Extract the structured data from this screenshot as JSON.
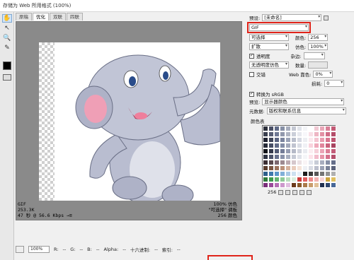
{
  "window": {
    "title": "存储为 Web 所用格式 (100%)"
  },
  "tabs": [
    {
      "label": "原稿"
    },
    {
      "label": "优化"
    },
    {
      "label": "双联"
    },
    {
      "label": "四联"
    }
  ],
  "image_info": {
    "format": "GIF",
    "size": "253.3K",
    "time": "47 秒 @ 56.6 Kbps",
    "time_arrow": "→≡",
    "dither": "100% 仿色",
    "palette": "\"可选择\" 调板",
    "colors": "256 颜色"
  },
  "statusbar": {
    "zoom": "100%",
    "r_label": "R:",
    "r_value": "--",
    "g_label": "G:",
    "g_value": "--",
    "b_label": "B:",
    "b_value": "--",
    "alpha_label": "Alpha:",
    "alpha_value": "--",
    "hex_label": "十六进制:",
    "hex_value": "--",
    "index_label": "索引:",
    "index_value": "--"
  },
  "settings": {
    "preset_label": "预设:",
    "preset_value": "[未命名]",
    "format_value": "GIF",
    "reduction_value": "可选择",
    "colors_label": "颜色:",
    "colors_value": "256",
    "dither_algo_value": "扩散",
    "dither_label": "仿色:",
    "dither_value": "100%",
    "transparency_label": "透明度",
    "matte_label": "杂边:",
    "transparency_dither_value": "无透明度仿色",
    "amount_label": "数量:",
    "interlaced_label": "交错",
    "web_snap_label": "Web 靠色:",
    "web_snap_value": "0%",
    "lossy_label": "损耗:",
    "lossy_value": "0",
    "convert_srgb_label": "转换为 sRGB",
    "preview_label": "预览:",
    "preview_value": "显示器颜色",
    "metadata_label": "元数据:",
    "metadata_value": "版权和联系信息"
  },
  "color_table": {
    "title": "颜色表",
    "count": "256",
    "colors": [
      "#2b2f3a",
      "#4a5066",
      "#5f6a86",
      "#8790a6",
      "#a7adbd",
      "#c4c8d3",
      "#e0e3ea",
      "#f3f4f7",
      "#ffffff",
      "#f1c9d3",
      "#e9a7b8",
      "#d98097",
      "#c35a76",
      "#3a3f4e",
      "#565d74",
      "#6f7894",
      "#9299ad",
      "#b0b5c3",
      "#cbcfd9",
      "#e6e8ee",
      "#f7f7fa",
      "#f8dfe6",
      "#eeb6c4",
      "#e390a4",
      "#cf6b86",
      "#b44d69",
      "#1f2230",
      "#404659",
      "#5a6380",
      "#7c859f",
      "#9ca3b7",
      "#babfcc",
      "#d5d8e1",
      "#eceef2",
      "#fbe9ee",
      "#f4c5d1",
      "#e99db0",
      "#d97590",
      "#bd5571",
      "#262a37",
      "#474e65",
      "#636c88",
      "#858ea7",
      "#a3a9bb",
      "#c0c4d0",
      "#dadde5",
      "#f0f1f5",
      "#f9d3dd",
      "#efaabb",
      "#e1869d",
      "#ca627d",
      "#a84460",
      "#111318",
      "#33384a",
      "#525a74",
      "#737c97",
      "#959cb1",
      "#b5bac8",
      "#d1d4dd",
      "#e9ebf0",
      "#fcedf1",
      "#f5cfd9",
      "#eba4b6",
      "#dc7e96",
      "#c35d79",
      "#2e3342",
      "#4d546b",
      "#68718d",
      "#8a93ab",
      "#a9afc0",
      "#c6cad5",
      "#dfe2e9",
      "#f4f5f8",
      "#fde3ea",
      "#f2bccb",
      "#e794a9",
      "#d46f8b",
      "#b4506c",
      "#3b2f33",
      "#5b4a4f",
      "#7c6870",
      "#9e8a91",
      "#bcaab0",
      "#d6c8cc",
      "#ebe1e4",
      "#f9f4f5",
      "#e3e6ee",
      "#c8ccd7",
      "#a8aebf",
      "#878fa6",
      "#666f8a",
      "#5a3d2e",
      "#7b5744",
      "#9c735e",
      "#bc927b",
      "#d5b19c",
      "#e9cdbd",
      "#f5e4da",
      "#eef0f4",
      "#d9dce4",
      "#bbbfcc",
      "#9aa1b4",
      "#7a8298",
      "#5b627b",
      "#2d5e8a",
      "#3f78ad",
      "#5b95c9",
      "#82b0d8",
      "#a9c9e5",
      "#cde0f0",
      "#e6f0f8",
      "#1d1d1d",
      "#3a3a3a",
      "#575757",
      "#747474",
      "#929292",
      "#b0b0b0",
      "#2e7a3a",
      "#3f9a4e",
      "#63b36f",
      "#8fca98",
      "#b8dfbd",
      "#daefdd",
      "#cc3b3b",
      "#e06060",
      "#ec8b8b",
      "#f3b3b3",
      "#f8d4d4",
      "#caa23a",
      "#e0c060",
      "#7a2e7a",
      "#9a4a9a",
      "#b46fb4",
      "#cc98cc",
      "#e0bfe0",
      "#6a3a1a",
      "#8a5a2a",
      "#aa7a4a",
      "#c89c6c",
      "#e0c098",
      "#203050",
      "#304870",
      "#486898"
    ]
  }
}
